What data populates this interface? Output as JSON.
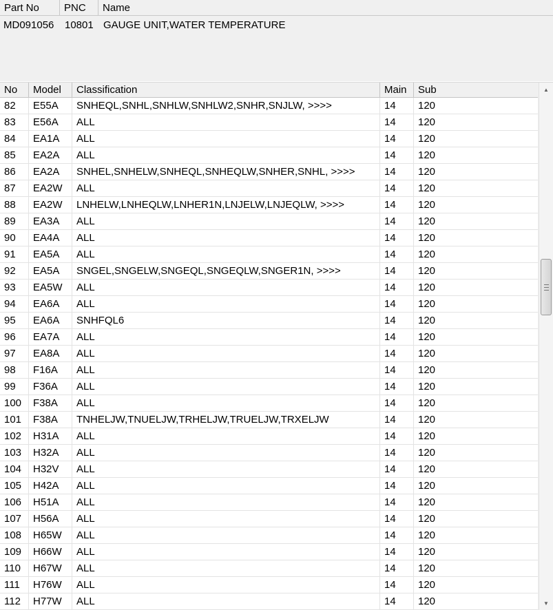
{
  "part_header": {
    "col_part_no": "Part No",
    "col_pnc": "PNC",
    "col_name": "Name"
  },
  "part": {
    "part_no": "MD091056",
    "pnc": "10801",
    "name": "GAUGE UNIT,WATER TEMPERATURE"
  },
  "grid_header": {
    "col_no": "No",
    "col_model": "Model",
    "col_classification": "Classification",
    "col_main": "Main",
    "col_sub": "Sub"
  },
  "scrollbar": {
    "up_icon": "scroll-up-arrow",
    "down_icon": "scroll-down-arrow"
  },
  "rows": [
    {
      "no": "82",
      "model": "E55A",
      "classification": "SNHEQL,SNHL,SNHLW,SNHLW2,SNHR,SNJLW,  >>>>",
      "main": "14",
      "sub": "120"
    },
    {
      "no": "83",
      "model": "E56A",
      "classification": "ALL",
      "main": "14",
      "sub": "120"
    },
    {
      "no": "84",
      "model": "EA1A",
      "classification": "ALL",
      "main": "14",
      "sub": "120"
    },
    {
      "no": "85",
      "model": "EA2A",
      "classification": "ALL",
      "main": "14",
      "sub": "120"
    },
    {
      "no": "86",
      "model": "EA2A",
      "classification": "SNHEL,SNHELW,SNHEQL,SNHEQLW,SNHER,SNHL,  >>>>",
      "main": "14",
      "sub": "120"
    },
    {
      "no": "87",
      "model": "EA2W",
      "classification": "ALL",
      "main": "14",
      "sub": "120"
    },
    {
      "no": "88",
      "model": "EA2W",
      "classification": "LNHELW,LNHEQLW,LNHER1N,LNJELW,LNJEQLW,  >>>>",
      "main": "14",
      "sub": "120"
    },
    {
      "no": "89",
      "model": "EA3A",
      "classification": "ALL",
      "main": "14",
      "sub": "120"
    },
    {
      "no": "90",
      "model": "EA4A",
      "classification": "ALL",
      "main": "14",
      "sub": "120"
    },
    {
      "no": "91",
      "model": "EA5A",
      "classification": "ALL",
      "main": "14",
      "sub": "120"
    },
    {
      "no": "92",
      "model": "EA5A",
      "classification": "SNGEL,SNGELW,SNGEQL,SNGEQLW,SNGER1N,  >>>>",
      "main": "14",
      "sub": "120"
    },
    {
      "no": "93",
      "model": "EA5W",
      "classification": "ALL",
      "main": "14",
      "sub": "120"
    },
    {
      "no": "94",
      "model": "EA6A",
      "classification": "ALL",
      "main": "14",
      "sub": "120"
    },
    {
      "no": "95",
      "model": "EA6A",
      "classification": "SNHFQL6",
      "main": "14",
      "sub": "120"
    },
    {
      "no": "96",
      "model": "EA7A",
      "classification": "ALL",
      "main": "14",
      "sub": "120"
    },
    {
      "no": "97",
      "model": "EA8A",
      "classification": "ALL",
      "main": "14",
      "sub": "120"
    },
    {
      "no": "98",
      "model": "F16A",
      "classification": "ALL",
      "main": "14",
      "sub": "120"
    },
    {
      "no": "99",
      "model": "F36A",
      "classification": "ALL",
      "main": "14",
      "sub": "120"
    },
    {
      "no": "100",
      "model": "F38A",
      "classification": "ALL",
      "main": "14",
      "sub": "120"
    },
    {
      "no": "101",
      "model": "F38A",
      "classification": "TNHELJW,TNUELJW,TRHELJW,TRUELJW,TRXELJW",
      "main": "14",
      "sub": "120"
    },
    {
      "no": "102",
      "model": "H31A",
      "classification": "ALL",
      "main": "14",
      "sub": "120"
    },
    {
      "no": "103",
      "model": "H32A",
      "classification": "ALL",
      "main": "14",
      "sub": "120"
    },
    {
      "no": "104",
      "model": "H32V",
      "classification": "ALL",
      "main": "14",
      "sub": "120"
    },
    {
      "no": "105",
      "model": "H42A",
      "classification": "ALL",
      "main": "14",
      "sub": "120"
    },
    {
      "no": "106",
      "model": "H51A",
      "classification": "ALL",
      "main": "14",
      "sub": "120"
    },
    {
      "no": "107",
      "model": "H56A",
      "classification": "ALL",
      "main": "14",
      "sub": "120"
    },
    {
      "no": "108",
      "model": "H65W",
      "classification": "ALL",
      "main": "14",
      "sub": "120"
    },
    {
      "no": "109",
      "model": "H66W",
      "classification": "ALL",
      "main": "14",
      "sub": "120"
    },
    {
      "no": "110",
      "model": "H67W",
      "classification": "ALL",
      "main": "14",
      "sub": "120"
    },
    {
      "no": "111",
      "model": "H76W",
      "classification": "ALL",
      "main": "14",
      "sub": "120"
    },
    {
      "no": "112",
      "model": "H77W",
      "classification": "ALL",
      "main": "14",
      "sub": "120"
    }
  ]
}
